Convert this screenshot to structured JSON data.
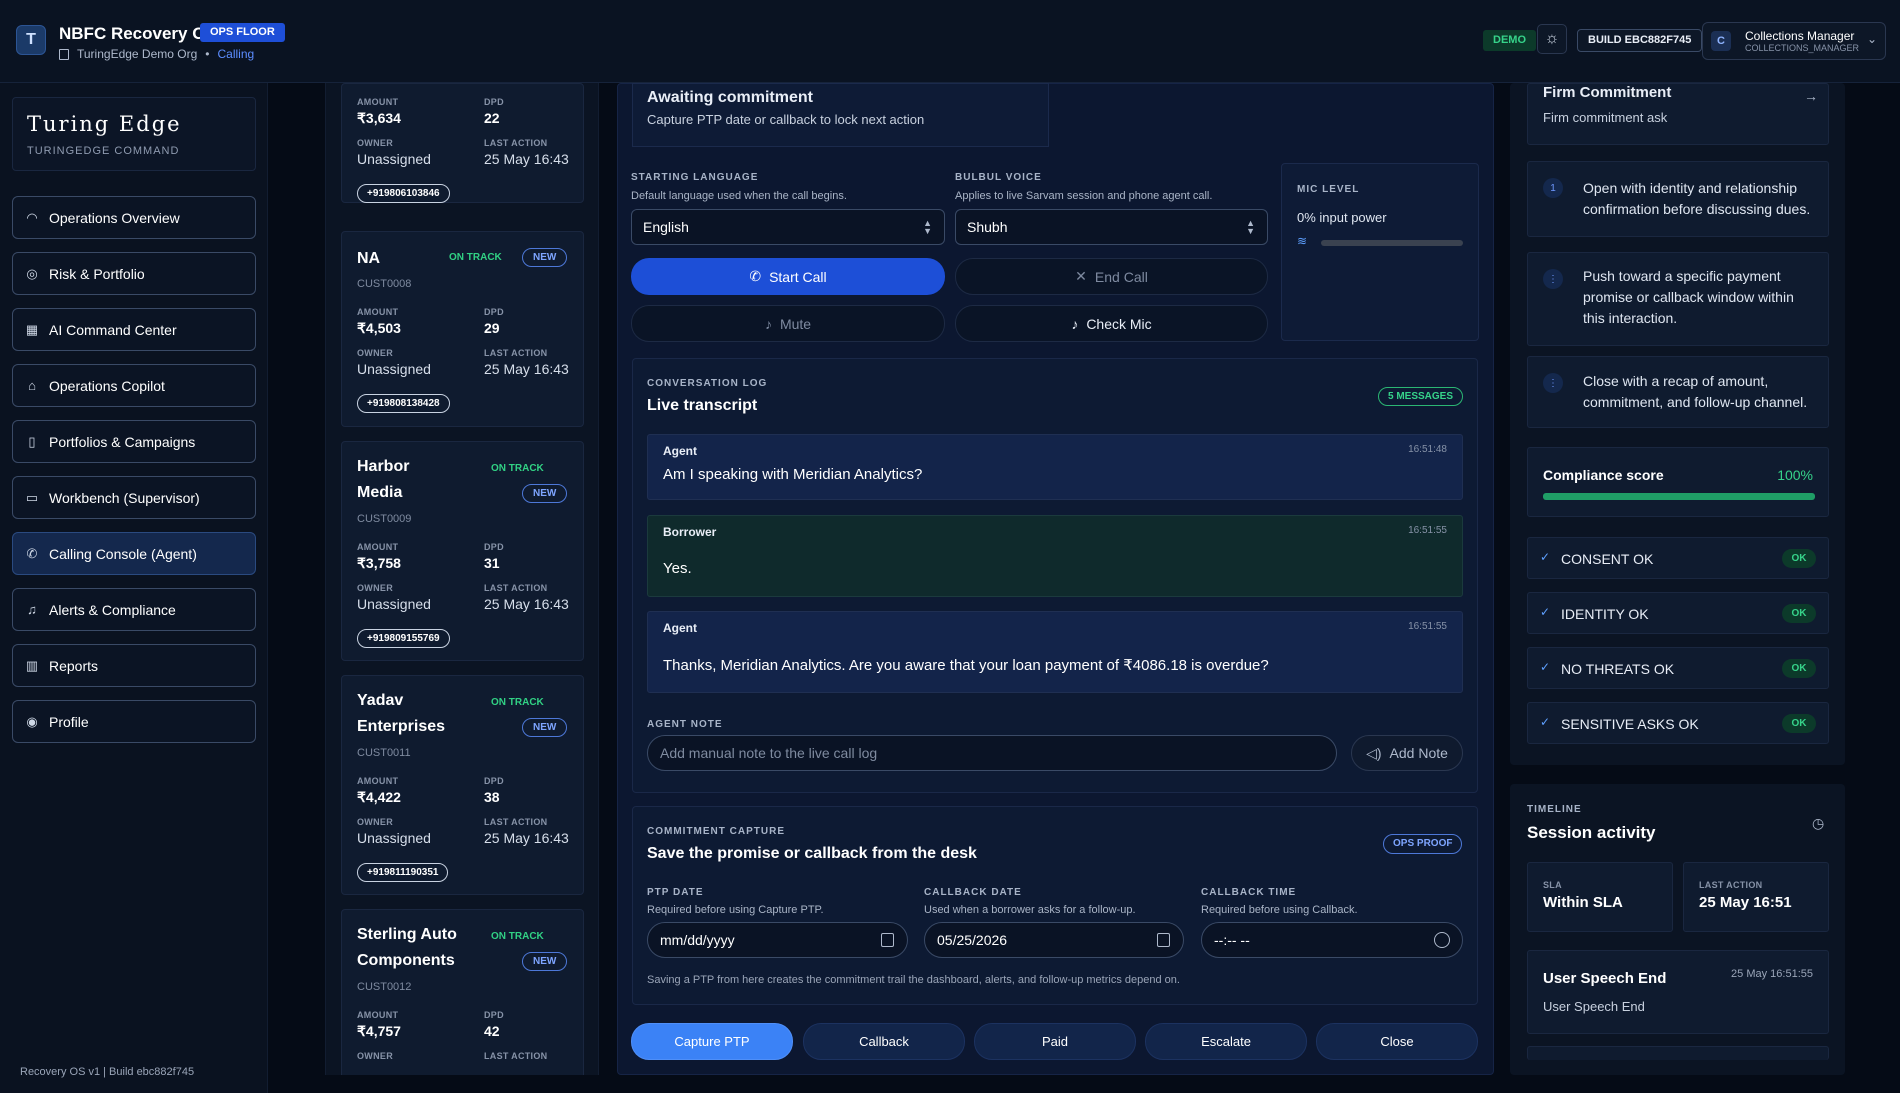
{
  "topbar": {
    "app_title": "NBFC Recovery OS",
    "ops_badge": "OPS FLOOR",
    "org": "TuringEdge Demo Org",
    "separator": "•",
    "section": "Calling",
    "demo": "DEMO",
    "build": "BUILD EBC882F745",
    "user_initial": "C",
    "user_name": "Collections Manager",
    "user_role": "COLLECTIONS_MANAGER"
  },
  "sidebar": {
    "brand": "Turing Edge",
    "brand_sub": "TURINGEDGE COMMAND",
    "items": [
      {
        "label": "Operations Overview",
        "icon": "dashboard-icon"
      },
      {
        "label": "Risk & Portfolio",
        "icon": "target-icon"
      },
      {
        "label": "AI Command Center",
        "icon": "grid-icon"
      },
      {
        "label": "Operations Copilot",
        "icon": "bot-icon"
      },
      {
        "label": "Portfolios & Campaigns",
        "icon": "file-icon"
      },
      {
        "label": "Workbench (Supervisor)",
        "icon": "briefcase-icon"
      },
      {
        "label": "Calling Console (Agent)",
        "icon": "phone-icon"
      },
      {
        "label": "Alerts & Compliance",
        "icon": "bell-icon"
      },
      {
        "label": "Reports",
        "icon": "chart-icon"
      },
      {
        "label": "Profile",
        "icon": "user-icon"
      }
    ],
    "footer": "Recovery OS v1 | Build ebc882f745"
  },
  "labels": {
    "amount": "AMOUNT",
    "dpd": "DPD",
    "owner": "OWNER",
    "last_action": "LAST ACTION",
    "on_track": "ON TRACK",
    "new": "NEW"
  },
  "customers": [
    {
      "amount": "₹3,634",
      "dpd": "22",
      "owner": "Unassigned",
      "last_action": "25 May 16:43",
      "phone": "+919806103846"
    },
    {
      "name": "NA",
      "id": "CUST0008",
      "amount": "₹4,503",
      "dpd": "29",
      "owner": "Unassigned",
      "last_action": "25 May 16:43",
      "phone": "+919808138428"
    },
    {
      "name_line1": "Harbor",
      "name_line2": "Media",
      "id": "CUST0009",
      "amount": "₹3,758",
      "dpd": "31",
      "owner": "Unassigned",
      "last_action": "25 May 16:43",
      "phone": "+919809155769"
    },
    {
      "name_line1": "Yadav",
      "name_line2": "Enterprises",
      "id": "CUST0011",
      "amount": "₹4,422",
      "dpd": "38",
      "owner": "Unassigned",
      "last_action": "25 May 16:43",
      "phone": "+919811190351"
    },
    {
      "name_line1": "Sterling Auto",
      "name_line2": "Components",
      "id": "CUST0012",
      "amount": "₹4,757",
      "dpd": "42"
    }
  ],
  "call": {
    "await_title": "Awaiting commitment",
    "await_sub": "Capture PTP date or callback to lock next action",
    "lang_label": "STARTING LANGUAGE",
    "lang_hint": "Default language used when the call begins.",
    "lang_value": "English",
    "voice_label": "BULBUL VOICE",
    "voice_hint": "Applies to live Sarvam session and phone agent call.",
    "voice_value": "Shubh",
    "start_call": "Start Call",
    "end_call": "End Call",
    "mute": "Mute",
    "check_mic": "Check Mic",
    "mic_label": "MIC LEVEL",
    "mic_value": "0% input power",
    "mic_level": 0
  },
  "log": {
    "label": "CONVERSATION LOG",
    "title": "Live transcript",
    "count": "5 MESSAGES",
    "messages": [
      {
        "who": "Agent",
        "time": "16:51:48",
        "text": "Am I speaking with Meridian Analytics?"
      },
      {
        "who": "Borrower",
        "time": "16:51:55",
        "text": "Yes."
      },
      {
        "who": "Agent",
        "time": "16:51:55",
        "text": "Thanks, Meridian Analytics. Are you aware that your loan payment of ₹4086.18 is overdue?"
      }
    ],
    "note_label": "AGENT NOTE",
    "note_placeholder": "Add manual note to the live call log",
    "add_note": "Add Note"
  },
  "commit": {
    "label": "COMMITMENT CAPTURE",
    "title": "Save the promise or callback from the desk",
    "badge": "OPS PROOF",
    "ptp_label": "PTP DATE",
    "ptp_hint": "Required before using Capture PTP.",
    "ptp_value": "mm/dd/yyyy",
    "cb_date_label": "CALLBACK DATE",
    "cb_date_hint": "Used when a borrower asks for a follow-up.",
    "cb_date_value": "05/25/2026",
    "cb_time_label": "CALLBACK TIME",
    "cb_time_hint": "Required before using Callback.",
    "cb_time_value": "--:-- --",
    "footnote": "Saving a PTP from here creates the commitment trail the dashboard, alerts, and follow-up metrics depend on."
  },
  "actions": [
    "Capture PTP",
    "Callback",
    "Paid",
    "Escalate",
    "Close"
  ],
  "right": {
    "firm_title": "Firm Commitment",
    "firm_sub": "Firm commitment ask",
    "steps": [
      {
        "num": "1",
        "text": "Open with identity and relationship confirmation before discussing dues."
      },
      {
        "num": "⋮",
        "text": "Push toward a specific payment promise or callback window within this interaction."
      },
      {
        "num": "⋮",
        "text": "Close with a recap of amount, commitment, and follow-up channel."
      }
    ],
    "compliance_label": "Compliance score",
    "compliance_value": "100%",
    "compliance_level": 1,
    "checks": [
      {
        "label": "CONSENT OK",
        "badge": "OK"
      },
      {
        "label": "IDENTITY OK",
        "badge": "OK"
      },
      {
        "label": "NO THREATS OK",
        "badge": "OK"
      },
      {
        "label": "SENSITIVE ASKS OK",
        "badge": "OK"
      }
    ]
  },
  "timeline": {
    "label": "TIMELINE",
    "title": "Session activity",
    "sla_label": "SLA",
    "sla_value": "Within SLA",
    "last_label": "LAST ACTION",
    "last_value": "25 May 16:51",
    "event_title": "User Speech End",
    "event_time": "25 May 16:51:55",
    "event_sub": "User Speech End"
  },
  "colors": {
    "accent": "#1d4fd7",
    "success": "#36d38a",
    "background": "#050b16"
  }
}
